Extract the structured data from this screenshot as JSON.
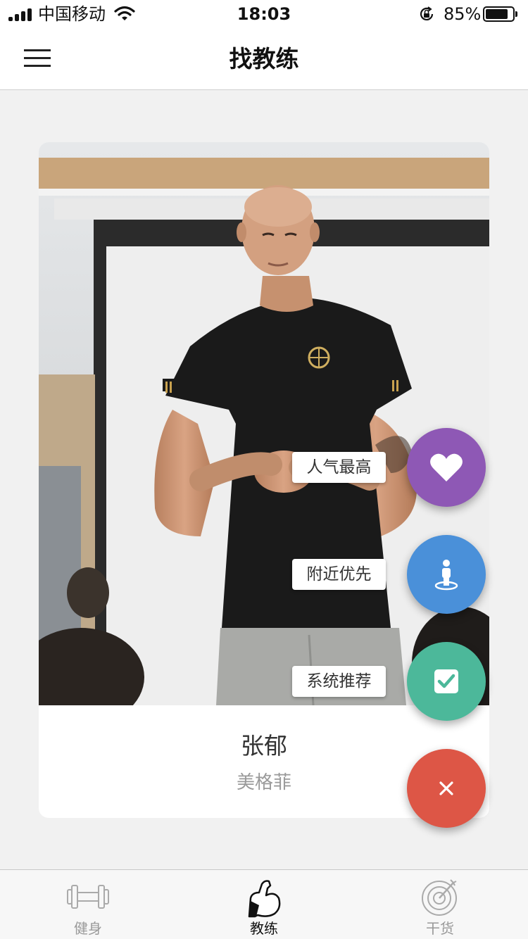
{
  "status_bar": {
    "carrier": "中国移动",
    "time": "18:03",
    "battery": "85%",
    "battery_level": 0.85
  },
  "nav": {
    "title": "找教练",
    "menu_icon": "hamburger-menu-icon"
  },
  "coach": {
    "name": "张郁",
    "gym": "美格菲"
  },
  "fab_menu": {
    "items": [
      {
        "label": "人气最高",
        "icon": "heart-icon",
        "color": "#8e58b5"
      },
      {
        "label": "附近优先",
        "icon": "location-person-icon",
        "color": "#4a90d9"
      },
      {
        "label": "系统推荐",
        "icon": "checkbox-icon",
        "color": "#4cb89a"
      }
    ],
    "close_icon": "close-icon",
    "close_color": "#dd5646"
  },
  "tabs": [
    {
      "label": "健身",
      "icon": "dumbbell-icon",
      "active": false
    },
    {
      "label": "教练",
      "icon": "flexed-arm-icon",
      "active": true
    },
    {
      "label": "干货",
      "icon": "target-icon",
      "active": false
    }
  ],
  "colors": {
    "background": "#f1f1f1",
    "tab_active": "#111111",
    "tab_inactive": "#999999"
  }
}
